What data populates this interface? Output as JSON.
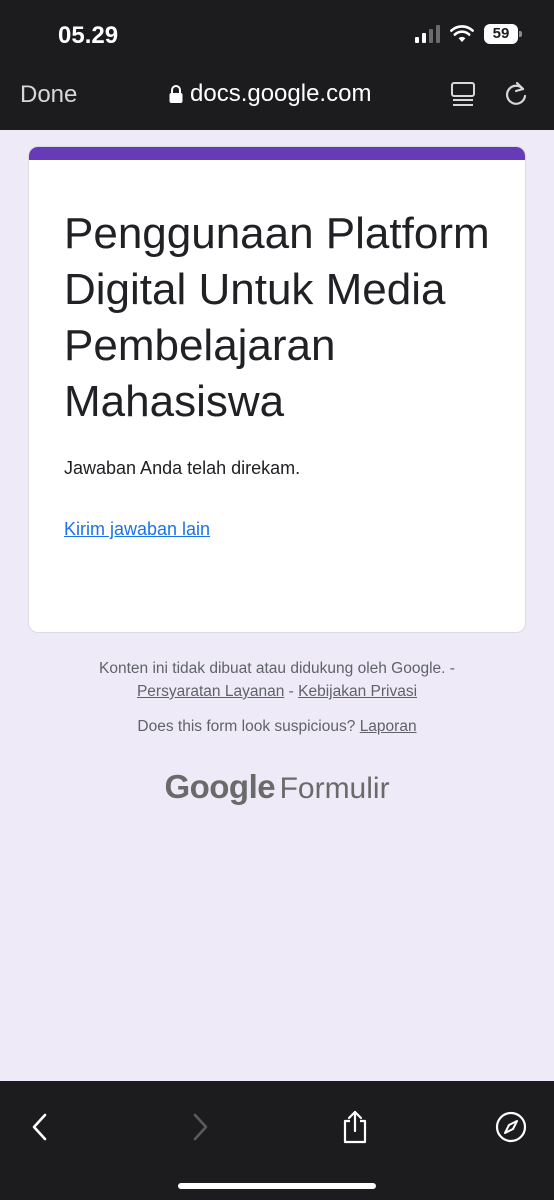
{
  "status": {
    "time": "05.29",
    "battery": "59"
  },
  "browser": {
    "done_label": "Done",
    "url": "docs.google.com"
  },
  "form": {
    "title": "Penggunaan Platform Digital Untuk Media Pembelajaran Mahasiswa",
    "confirmation": "Jawaban Anda telah direkam.",
    "another_response": "Kirim jawaban lain"
  },
  "footer": {
    "disclaimer": "Konten ini tidak dibuat atau didukung oleh Google. -",
    "terms": "Persyaratan Layanan",
    "separator": "-",
    "privacy": "Kebijakan Privasi",
    "suspicious": "Does this form look suspicious?",
    "report": "Laporan",
    "brand_google": "Google",
    "brand_product": "Formulir"
  },
  "colors": {
    "accent": "#673ab7",
    "link": "#1a73e8",
    "background": "#efeaf8"
  },
  "icons": [
    "lock-icon",
    "reader-icon",
    "reload-icon",
    "back-icon",
    "forward-icon",
    "share-icon",
    "compass-icon",
    "wifi-icon",
    "signal-icon",
    "battery-icon"
  ]
}
